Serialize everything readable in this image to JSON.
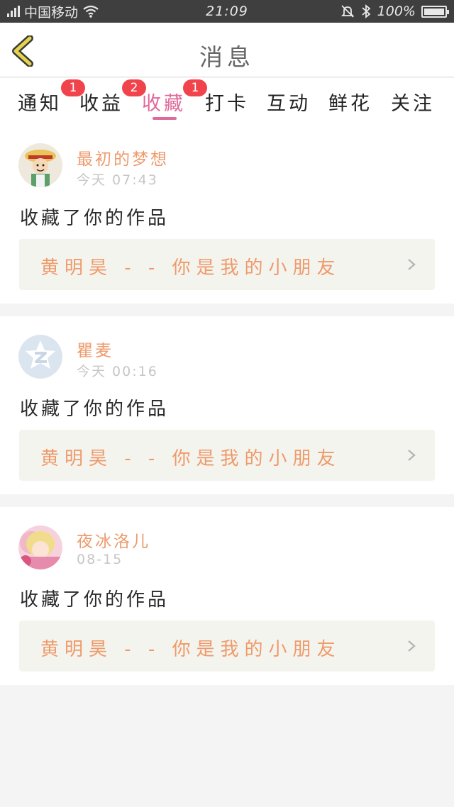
{
  "status_bar": {
    "carrier": "中国移动",
    "time": "21:09",
    "battery": "100%",
    "icons": [
      "signal-icon",
      "wifi-icon",
      "mute-icon",
      "bluetooth-icon",
      "battery-icon"
    ]
  },
  "header": {
    "title": "消息",
    "back_icon": "chevron-left-icon",
    "accent_color": "#e6d44c"
  },
  "tabs": [
    {
      "label": "通知",
      "badge": "1",
      "active": false
    },
    {
      "label": "收益",
      "badge": "2",
      "active": false
    },
    {
      "label": "收藏",
      "badge": "1",
      "active": true
    },
    {
      "label": "打卡",
      "badge": null,
      "active": false
    },
    {
      "label": "互动",
      "badge": null,
      "active": false
    },
    {
      "label": "鲜花",
      "badge": null,
      "active": false
    },
    {
      "label": "关注",
      "badge": null,
      "active": false
    }
  ],
  "colors": {
    "active_tab": "#e0699b",
    "badge": "#f0434b",
    "username": "#ee9a6c",
    "work_title": "#ef9a6a"
  },
  "messages": [
    {
      "username": "最初的梦想",
      "time": "今天 07:43",
      "action": "收藏了你的作品",
      "work_title": "黄明昊 - - 你是我的小朋友",
      "avatar": "cartoon-avatar"
    },
    {
      "username": "瞿麦",
      "time": "今天 00:16",
      "action": "收藏了你的作品",
      "work_title": "黄明昊 - - 你是我的小朋友",
      "avatar": "default-avatar"
    },
    {
      "username": "夜冰洛儿",
      "time": "08-15",
      "action": "收藏了你的作品",
      "work_title": "黄明昊 - - 你是我的小朋友",
      "avatar": "photo-avatar"
    }
  ]
}
